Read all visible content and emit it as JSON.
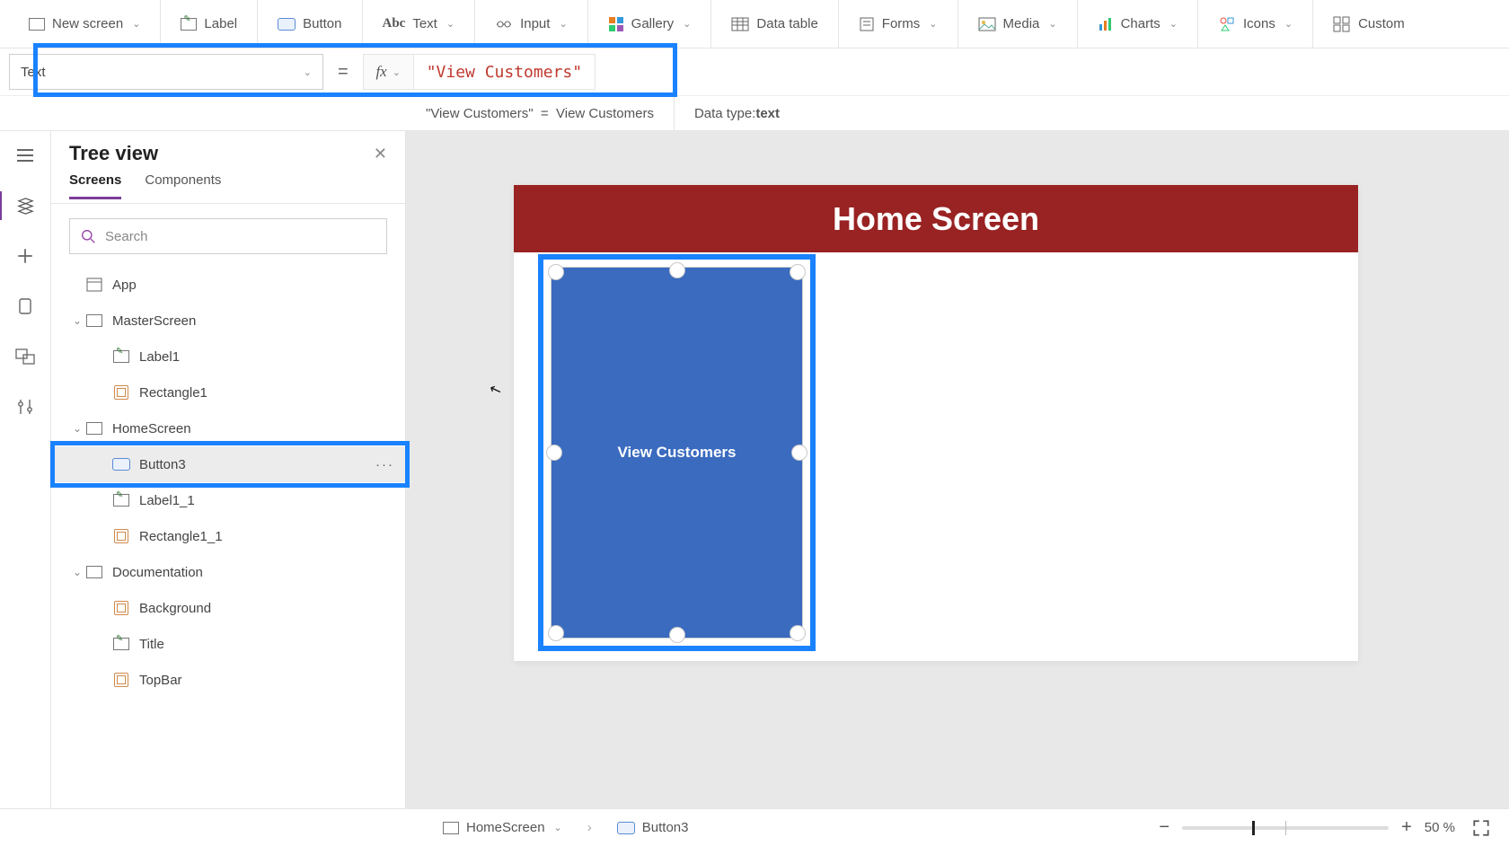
{
  "ribbon": [
    {
      "icon": "screen",
      "label": "New screen",
      "chev": true
    },
    {
      "icon": "label",
      "label": "Label"
    },
    {
      "icon": "button",
      "label": "Button"
    },
    {
      "icon": "text",
      "label": "Text",
      "chev": true
    },
    {
      "icon": "input",
      "label": "Input",
      "chev": true
    },
    {
      "icon": "gallery",
      "label": "Gallery",
      "chev": true
    },
    {
      "icon": "table",
      "label": "Data table"
    },
    {
      "icon": "forms",
      "label": "Forms",
      "chev": true
    },
    {
      "icon": "media",
      "label": "Media",
      "chev": true
    },
    {
      "icon": "charts",
      "label": "Charts",
      "chev": true
    },
    {
      "icon": "icons",
      "label": "Icons",
      "chev": true
    },
    {
      "icon": "custom",
      "label": "Custom"
    }
  ],
  "formula": {
    "property": "Text",
    "value": "\"View Customers\""
  },
  "result": {
    "lhs": "\"View Customers\"",
    "rhs": "View Customers",
    "datatypeLabel": "Data type: ",
    "datatype": "text"
  },
  "tree": {
    "title": "Tree view",
    "tabs": [
      {
        "label": "Screens",
        "active": true
      },
      {
        "label": "Components"
      }
    ],
    "searchPlaceholder": "Search",
    "items": [
      {
        "depth": 0,
        "icon": "app",
        "label": "App"
      },
      {
        "depth": 0,
        "icon": "screen",
        "label": "MasterScreen",
        "expander": "v"
      },
      {
        "depth": 1,
        "icon": "label",
        "label": "Label1"
      },
      {
        "depth": 1,
        "icon": "shape",
        "label": "Rectangle1"
      },
      {
        "depth": 0,
        "icon": "screen",
        "label": "HomeScreen",
        "expander": "v"
      },
      {
        "depth": 1,
        "icon": "button",
        "label": "Button3",
        "selected": true
      },
      {
        "depth": 1,
        "icon": "label",
        "label": "Label1_1"
      },
      {
        "depth": 1,
        "icon": "shape",
        "label": "Rectangle1_1"
      },
      {
        "depth": 0,
        "icon": "screen",
        "label": "Documentation",
        "expander": "v"
      },
      {
        "depth": 1,
        "icon": "shape",
        "label": "Background"
      },
      {
        "depth": 1,
        "icon": "label",
        "label": "Title"
      },
      {
        "depth": 1,
        "icon": "shape",
        "label": "TopBar"
      }
    ]
  },
  "canvas": {
    "headerTitle": "Home Screen",
    "buttonText": "View Customers"
  },
  "status": {
    "crumb1": "HomeScreen",
    "crumb2": "Button3",
    "zoomValue": "50",
    "zoomUnit": "%"
  }
}
